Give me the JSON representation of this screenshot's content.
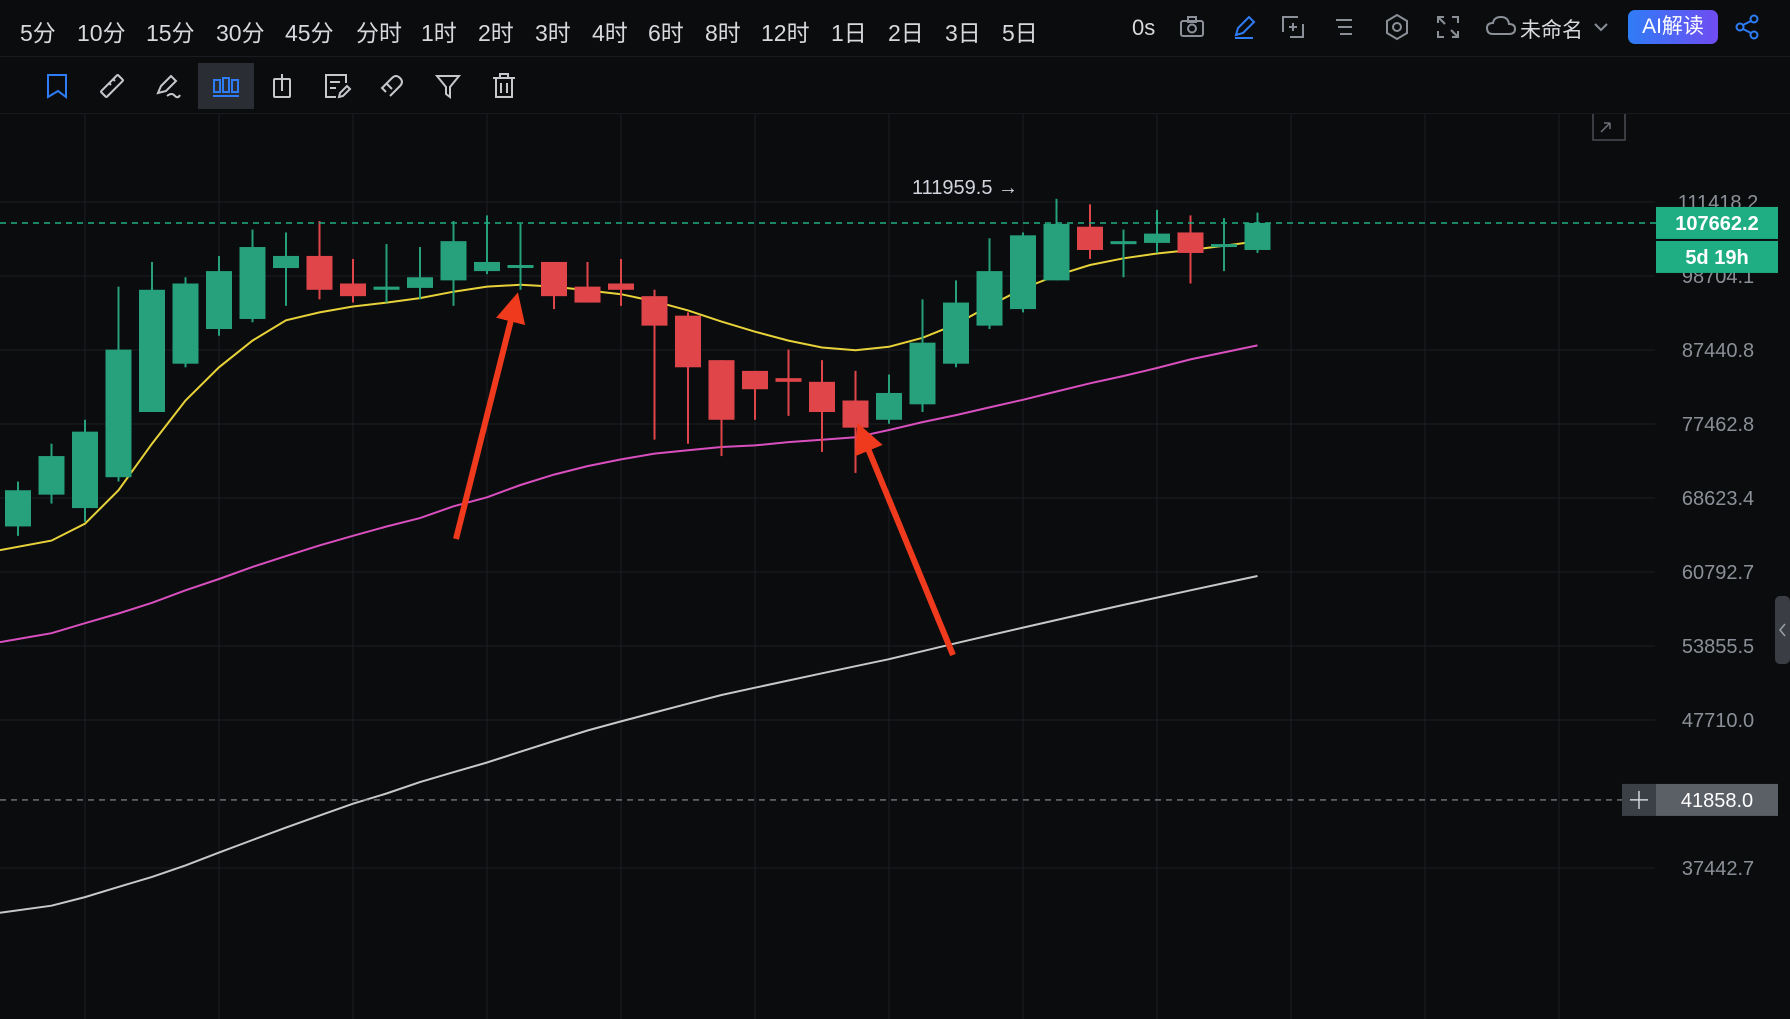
{
  "timeframes": [
    "5分",
    "10分",
    "15分",
    "30分",
    "45分",
    "分时",
    "1时",
    "2时",
    "3时",
    "4时",
    "6时",
    "8时",
    "12时",
    "1日",
    "2日",
    "3日",
    "5日"
  ],
  "toolbar": {
    "countdown": "0s",
    "layout_name": "未命名",
    "ai_button": "AI解读"
  },
  "chart_data": {
    "type": "candlestick",
    "y_ticks": [
      "111418.2",
      "98704.1",
      "87440.8",
      "77462.8",
      "68623.4",
      "60792.7",
      "53855.5",
      "47710.0",
      "37442.7"
    ],
    "y_scale": "log",
    "ylim": [
      36000,
      125000
    ],
    "last_price": "107662.2",
    "last_price_value": 107662.2,
    "countdown_label": "5d 19h",
    "crosshair_price": "41858.0",
    "crosshair_value": 41858.0,
    "high_marker": "111959.5",
    "high_marker_value": 111959.5,
    "colors": {
      "up": "#26a17b",
      "down": "#e0454a",
      "ma_fast": "#e8d23a",
      "ma_mid": "#d94fbf",
      "ma_slow": "#c8c8c8",
      "arrow": "#f03a1e",
      "grid": "#1c1e22",
      "price_tag": "#1fae84"
    },
    "candles": [
      {
        "o": 65500,
        "h": 70500,
        "l": 64500,
        "c": 69500
      },
      {
        "o": 69000,
        "h": 75000,
        "l": 68000,
        "c": 73500
      },
      {
        "o": 67500,
        "h": 78000,
        "l": 66000,
        "c": 76500
      },
      {
        "o": 71000,
        "h": 97000,
        "l": 70500,
        "c": 87500
      },
      {
        "o": 79000,
        "h": 101000,
        "l": 79000,
        "c": 96500
      },
      {
        "o": 85500,
        "h": 98500,
        "l": 85000,
        "c": 97500
      },
      {
        "o": 90500,
        "h": 102000,
        "l": 89500,
        "c": 99500
      },
      {
        "o": 92000,
        "h": 106500,
        "l": 91500,
        "c": 103500
      },
      {
        "o": 100000,
        "h": 106000,
        "l": 94000,
        "c": 102000
      },
      {
        "o": 102000,
        "h": 108000,
        "l": 95000,
        "c": 96500
      },
      {
        "o": 97500,
        "h": 101500,
        "l": 94500,
        "c": 95500
      },
      {
        "o": 96500,
        "h": 104000,
        "l": 94500,
        "c": 97000
      },
      {
        "o": 96800,
        "h": 103500,
        "l": 95000,
        "c": 98500
      },
      {
        "o": 98000,
        "h": 108000,
        "l": 94000,
        "c": 104500
      },
      {
        "o": 99500,
        "h": 109000,
        "l": 99000,
        "c": 101000
      },
      {
        "o": 100500,
        "h": 107500,
        "l": 96500,
        "c": 100500
      },
      {
        "o": 101000,
        "h": 100500,
        "l": 93500,
        "c": 95500
      },
      {
        "o": 97000,
        "h": 101000,
        "l": 94500,
        "c": 94500
      },
      {
        "o": 97500,
        "h": 101500,
        "l": 94000,
        "c": 96500
      },
      {
        "o": 95500,
        "h": 96500,
        "l": 75500,
        "c": 91000
      },
      {
        "o": 92500,
        "h": 93000,
        "l": 75000,
        "c": 85000
      },
      {
        "o": 86000,
        "h": 86000,
        "l": 73500,
        "c": 78000
      },
      {
        "o": 84500,
        "h": 84500,
        "l": 78000,
        "c": 82000
      },
      {
        "o": 83500,
        "h": 87500,
        "l": 78500,
        "c": 83000
      },
      {
        "o": 83000,
        "h": 86000,
        "l": 74000,
        "c": 79000
      },
      {
        "o": 80500,
        "h": 84500,
        "l": 71500,
        "c": 77000
      },
      {
        "o": 78000,
        "h": 84000,
        "l": 77500,
        "c": 81500
      },
      {
        "o": 80000,
        "h": 95000,
        "l": 79000,
        "c": 88500
      },
      {
        "o": 85500,
        "h": 98000,
        "l": 85000,
        "c": 94500
      },
      {
        "o": 91000,
        "h": 105000,
        "l": 90500,
        "c": 99500
      },
      {
        "o": 93500,
        "h": 106000,
        "l": 93000,
        "c": 105500
      },
      {
        "o": 98000,
        "h": 112000,
        "l": 98000,
        "c": 107500
      },
      {
        "o": 107000,
        "h": 111000,
        "l": 101500,
        "c": 103000
      },
      {
        "o": 104000,
        "h": 106500,
        "l": 98500,
        "c": 104500
      },
      {
        "o": 104200,
        "h": 110000,
        "l": 102500,
        "c": 105800
      },
      {
        "o": 106000,
        "h": 109000,
        "l": 97500,
        "c": 102500
      },
      {
        "o": 103800,
        "h": 108500,
        "l": 99500,
        "c": 104000
      },
      {
        "o": 103000,
        "h": 109500,
        "l": 102500,
        "c": 107662
      }
    ],
    "ma_fast": [
      63000,
      64000,
      65800,
      69500,
      75000,
      80500,
      85000,
      88800,
      91800,
      93000,
      93900,
      94500,
      95200,
      96200,
      97000,
      97300,
      97000,
      96400,
      95800,
      94700,
      93300,
      91600,
      90100,
      88800,
      87800,
      87400,
      87900,
      89200,
      91200,
      94000,
      96700,
      98800,
      100500,
      101600,
      102400,
      103000,
      103700,
      104500
    ],
    "ma_mid": [
      54200,
      55000,
      55900,
      56800,
      57800,
      59000,
      60100,
      61300,
      62400,
      63500,
      64500,
      65500,
      66400,
      67700,
      68700,
      70100,
      71300,
      72300,
      73100,
      73800,
      74200,
      74600,
      74800,
      75200,
      75500,
      75800,
      76700,
      77700,
      78600,
      79600,
      80600,
      81700,
      82800,
      83800,
      84900,
      86100,
      87100,
      88100
    ],
    "ma_slow": [
      34800,
      35200,
      35700,
      36300,
      36900,
      37600,
      38400,
      39200,
      40000,
      40800,
      41600,
      42300,
      43100,
      43800,
      44500,
      45300,
      46100,
      46900,
      47600,
      48300,
      49000,
      49700,
      50300,
      50900,
      51500,
      52100,
      52700,
      53400,
      54100,
      54800,
      55500,
      56200,
      56900,
      57600,
      58300,
      59000,
      59700,
      60400
    ]
  }
}
